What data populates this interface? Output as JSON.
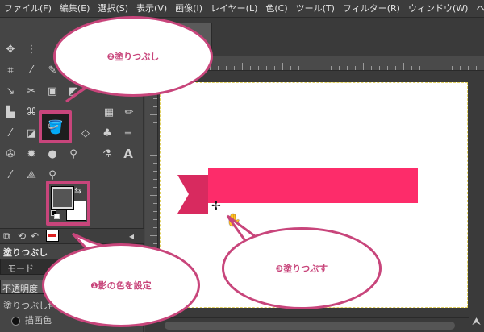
{
  "menubar": [
    "ファイル(F)",
    "編集(E)",
    "選択(S)",
    "表示(V)",
    "画像(I)",
    "レイヤー(L)",
    "色(C)",
    "ツール(T)",
    "フィルター(R)",
    "ウィンドウ(W)",
    "ヘルプ(H)"
  ],
  "tools": {
    "row1": [
      "move-icon",
      "align-icon",
      "free-select-icon",
      "rect-select-icon"
    ],
    "row2": [
      "crop-icon",
      "fuzzy-select-icon",
      "paths-icon",
      "text-select-icon"
    ],
    "row3": [
      "transform-icon",
      "scissors-icon",
      "perspective-icon",
      "warp-icon"
    ],
    "row4": [
      "heal-icon",
      "cage-icon",
      "bucket-fill-icon",
      "pencil-icon"
    ],
    "row5": [
      "brush-icon",
      "blend-icon",
      "eraser-icon",
      "airbrush-icon"
    ],
    "row6": [
      "clone-icon",
      "smudge-icon",
      "ink-icon",
      "dodge-icon"
    ],
    "row7": [
      "color-picker-icon",
      "measure-icon",
      "zoom-icon",
      "text-icon"
    ]
  },
  "colors": {
    "accent": "#c8457b",
    "ribbon": "#fd2c6a",
    "foreground": "#555555",
    "background": "#ffffff"
  },
  "tool_options": {
    "title": "塗りつぶし",
    "mode_label": "モード",
    "opacity_label": "不透明度",
    "fill_type_label": "塗りつぶし色",
    "radio_label": "描画色"
  },
  "callouts": {
    "step1": "❶影の色を設定",
    "step2": "❷塗りつぶし",
    "step3": "❸塗りつぶす"
  }
}
